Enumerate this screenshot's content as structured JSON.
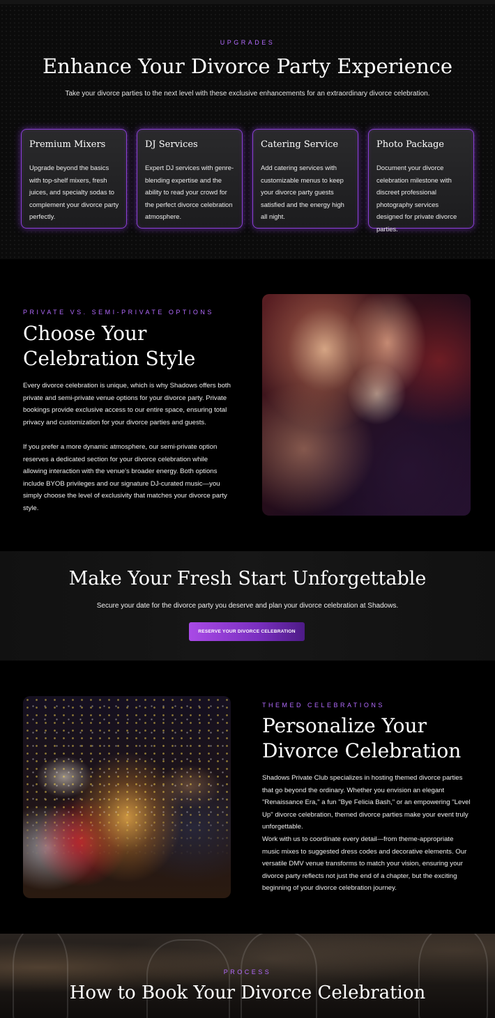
{
  "upgrades": {
    "eyebrow": "UPGRADES",
    "title": "Enhance Your Divorce Party Experience",
    "lead": "Take your divorce parties to the next level with these exclusive enhancements for an extraordinary divorce celebration.",
    "cards": [
      {
        "title": "Premium Mixers",
        "text": "Upgrade beyond the basics with top-shelf mixers, fresh juices, and specialty sodas to complement your divorce party perfectly."
      },
      {
        "title": "DJ Services",
        "text": "Expert DJ services with genre-blending expertise and the ability to read your crowd for the perfect divorce celebration atmosphere."
      },
      {
        "title": "Catering Service",
        "text": "Add catering services with customizable menus to keep your divorce party guests satisfied and the energy high all night."
      },
      {
        "title": "Photo Package",
        "text": "Document your divorce celebration milestone with discreet professional photography services designed for private divorce parties."
      }
    ]
  },
  "style_section": {
    "eyebrow": "PRIVATE VS. SEMI-PRIVATE OPTIONS",
    "title_line1": "Choose Your",
    "title_line2": "Celebration Style",
    "para1": "Every divorce celebration is unique, which is why Shadows offers both private and semi-private venue options for your divorce party. Private bookings provide exclusive access to our entire space, ensuring total privacy and customization for your divorce parties and guests.",
    "para2": "If you prefer a more dynamic atmosphere, our semi-private option reserves a dedicated section for your divorce celebration while allowing interaction with the venue's broader energy. Both options include BYOB privileges and our signature DJ-curated music—you simply choose the level of exclusivity that matches your divorce party style."
  },
  "cta": {
    "title": "Make Your Fresh Start Unforgettable",
    "text": "Secure your date for the divorce party you deserve and plan your divorce celebration at Shadows.",
    "button": "RESERVE YOUR DIVORCE CELEBRATION"
  },
  "themed": {
    "eyebrow": "THEMED CELEBRATIONS",
    "title_line1": "Personalize Your",
    "title_line2": "Divorce Celebration",
    "para1": "Shadows Private Club specializes in hosting themed divorce parties that go beyond the ordinary. Whether you envision an elegant \"Renaissance Era,\" a fun \"Bye Felicia Bash,\" or an empowering \"Level Up\" divorce celebration, themed divorce parties make your event truly unforgettable.",
    "para2": "Work with us to coordinate every detail—from theme-appropriate music mixes to suggested dress codes and decorative elements. Our versatile DMV venue transforms to match your vision, ensuring your divorce party reflects not just the end of a chapter, but the exciting beginning of your divorce celebration journey."
  },
  "process": {
    "eyebrow": "PROCESS",
    "title": "How to Book Your Divorce Celebration"
  },
  "colors": {
    "accent": "#b36bff",
    "card_border": "#8a3fd6",
    "button_start": "#a94ae6",
    "button_end": "#4d1b86"
  }
}
